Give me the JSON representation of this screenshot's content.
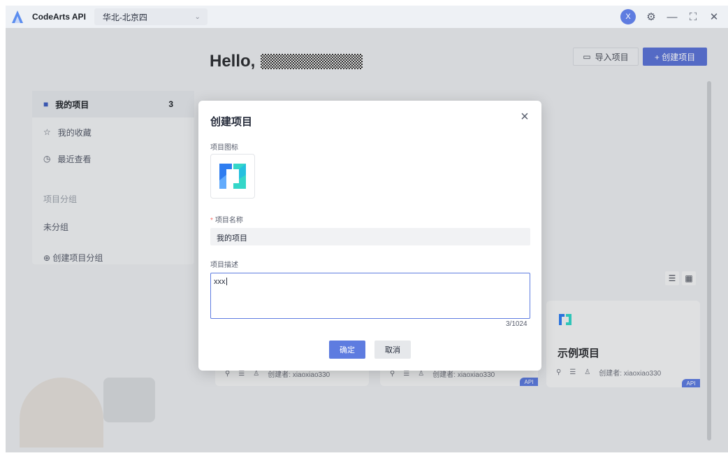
{
  "titlebar": {
    "app_name": "CodeArts API",
    "region": "华北-北京四",
    "avatar_initial": "X"
  },
  "header": {
    "greeting": "Hello,",
    "import_label": "导入项目",
    "create_label": "+ 创建项目"
  },
  "sidebar": {
    "my_projects": "我的项目",
    "my_projects_count": "3",
    "favorites": "我的收藏",
    "recent": "最近查看",
    "group_heading": "项目分组",
    "ungrouped": "未分组",
    "create_group": "创建项目分组"
  },
  "cards": [
    {
      "creator": "创建者: xiaoxiao330",
      "badge": ""
    },
    {
      "creator": "创建者: xiaoxiao330",
      "badge": "API"
    },
    {
      "title": "示例项目",
      "creator": "创建者: xiaoxiao330",
      "badge": "API"
    }
  ],
  "modal": {
    "title": "创建项目",
    "icon_label": "项目图标",
    "name_label": "项目名称",
    "name_value": "我的项目",
    "desc_label": "项目描述",
    "desc_value": "xxx",
    "counter": "3/1024",
    "ok_label": "确定",
    "cancel_label": "取消"
  },
  "colors": {
    "accent": "#5e7ce0",
    "required": "#f66f6a"
  }
}
